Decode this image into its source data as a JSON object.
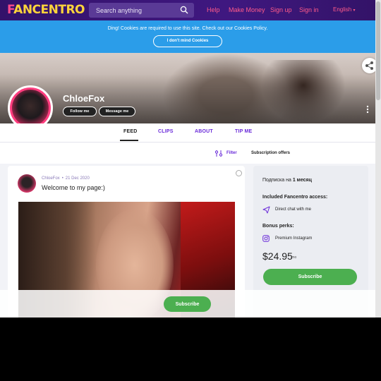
{
  "header": {
    "logo_first": "F",
    "logo_rest": "ANCENTRO",
    "search_placeholder": "Search anything",
    "nav": [
      "Help",
      "Make Money",
      "Sign up",
      "Sign in"
    ],
    "language": "English"
  },
  "cookie_banner": {
    "text": "Ding! Cookies are required to use this site. Check out our Cookies Policy.",
    "button": "I don't mind Cookies"
  },
  "profile": {
    "name": "ChloeFox",
    "follow_label": "Follow me",
    "message_label": "Message me"
  },
  "tabs": [
    {
      "label": "FEED",
      "active": true
    },
    {
      "label": "CLIPS",
      "active": false
    },
    {
      "label": "ABOUT",
      "active": false
    },
    {
      "label": "TIP ME",
      "active": false
    }
  ],
  "filter_bar": {
    "filter_label": "Filter",
    "offers_label": "Subscription offers"
  },
  "post": {
    "author": "ChloeFox",
    "date": "21 Dec 2020",
    "title": "Welcome to my page:)"
  },
  "offer": {
    "period_prefix": "Подписка на ",
    "period_bold": "1 месяц",
    "included_title": "Included Fancentro access:",
    "included_items": [
      "Direct chat with me"
    ],
    "bonus_title": "Bonus perks:",
    "bonus_items": [
      "Premium Instagram"
    ],
    "price": "$24.95",
    "price_unit": "/mo",
    "subscribe_label": "Subscribe"
  },
  "sticky": {
    "subscribe_label": "Subscribe"
  },
  "colors": {
    "nav_bg": "#3a1577",
    "accent_pink": "#ff5a8a",
    "link_purple": "#6a2bd9",
    "cookie_blue": "#2b9de9",
    "subscribe_green": "#4caf50"
  },
  "icons": [
    "search-icon",
    "share-icon",
    "more-vertical-icon",
    "filter-icon",
    "info-icon",
    "send-icon",
    "instagram-icon",
    "chevron-down-icon"
  ]
}
